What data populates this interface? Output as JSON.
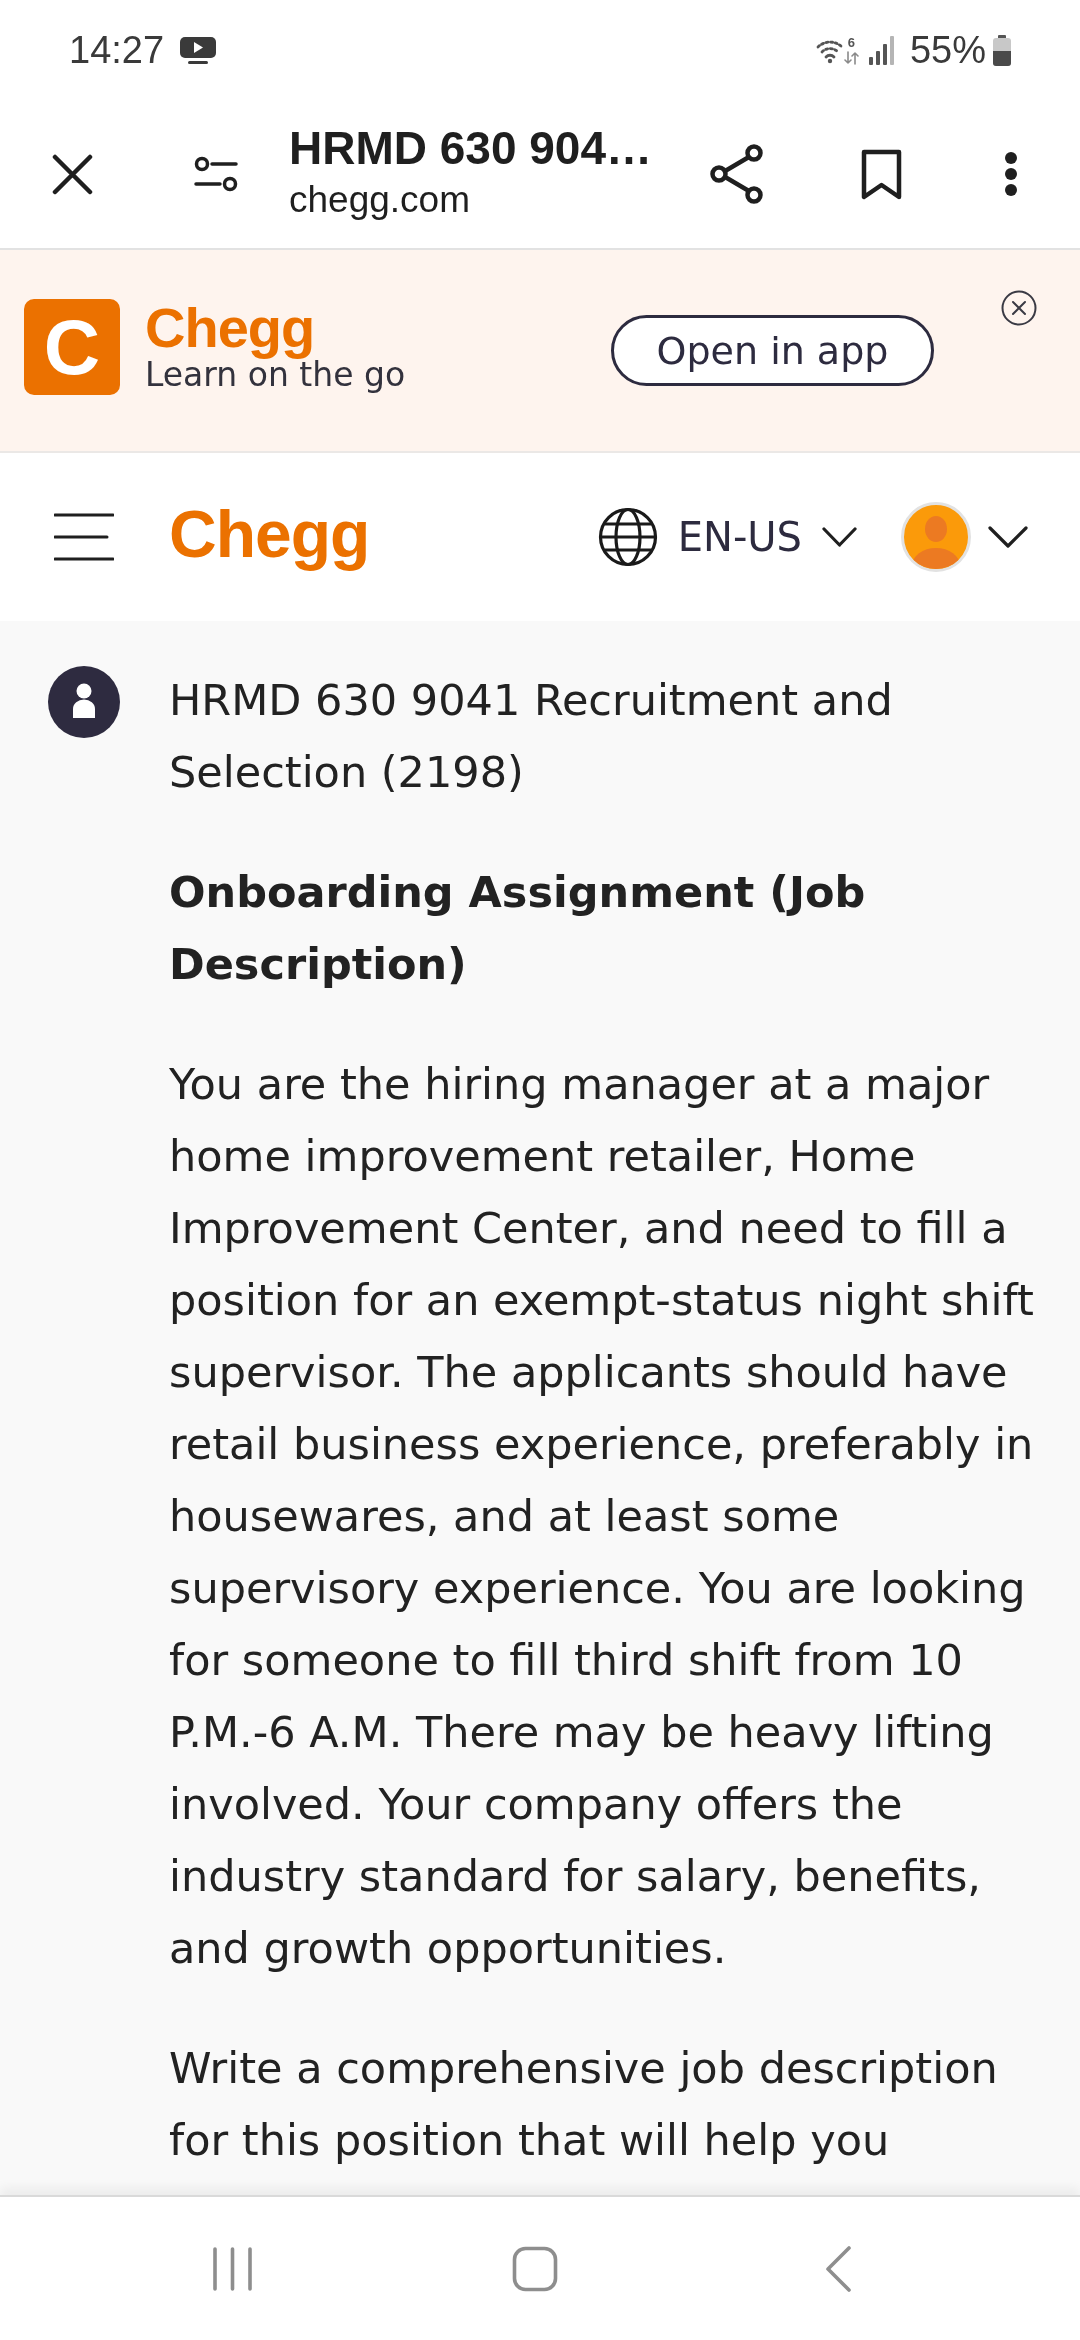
{
  "status_bar": {
    "time": "14:27",
    "wifi_label": "6",
    "battery": "55%"
  },
  "browser_toolbar": {
    "title": "HRMD 630 904…",
    "domain": "chegg.com"
  },
  "app_banner": {
    "app_icon": "C",
    "brand": "Chegg",
    "tagline": "Learn on the go",
    "button": "Open in app"
  },
  "site_header": {
    "logo": "Chegg",
    "language": "EN-US"
  },
  "question": {
    "title": "HRMD 630 9041 Recruitment and Selection (2198)",
    "heading": "Onboarding Assignment (Job Description)",
    "paragraphs": [
      "You are the hiring manager at a major home improvement retailer, Home Improvement Center, and need to fill a position for an exempt-status night shift supervisor. The applicants should have retail business experience, preferably in housewares, and at least some supervisory experience. You are looking for someone to fill third shift from 10 P.M.-6 A.M. There may be heavy lifting involved. Your company offers the industry standard for salary, benefits, and growth opportunities.",
      "Write a comprehensive job description for this position that will help you"
    ]
  }
}
